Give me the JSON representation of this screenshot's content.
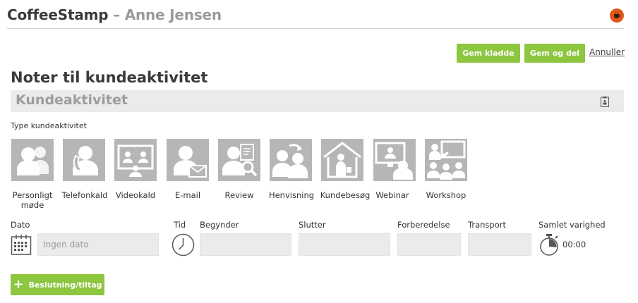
{
  "header": {
    "brand": "CoffeeStamp",
    "separator": " – ",
    "user_name": "Anne Jensen",
    "logo_icon": "coffee-cup-icon",
    "logo_color": "#e0581e"
  },
  "toolbar": {
    "save_draft_label": "Gem kladde",
    "save_share_label": "Gem og del",
    "cancel_label": "Annuller",
    "accent_color": "#8dc63f"
  },
  "page": {
    "title": "Noter til kundeaktivitet",
    "activity_title": "Kundeaktivitet",
    "attachment_icon": "clipboard-icon"
  },
  "activity_types": {
    "label": "Type kundeaktivitet",
    "items": [
      {
        "line1": "Personligt",
        "line2": "møde",
        "icon": "meeting-icon"
      },
      {
        "line1": "Telefonkald",
        "line2": "",
        "icon": "phone-call-icon"
      },
      {
        "line1": "Videokald",
        "line2": "",
        "icon": "video-call-icon"
      },
      {
        "line1": "E-mail",
        "line2": "",
        "icon": "email-icon"
      },
      {
        "line1": "Review",
        "line2": "",
        "icon": "review-icon"
      },
      {
        "line1": "Henvisning",
        "line2": "",
        "icon": "referral-icon"
      },
      {
        "line1": "Kundebesøg",
        "line2": "",
        "icon": "customer-visit-icon"
      },
      {
        "line1": "Webinar",
        "line2": "",
        "icon": "webinar-icon"
      },
      {
        "line1": "Workshop",
        "line2": "",
        "icon": "workshop-icon"
      }
    ]
  },
  "fields": {
    "date_label": "Dato",
    "date_placeholder": "Ingen dato",
    "date_value": "",
    "time_label": "Tid",
    "start_label": "Begynder",
    "start_value": "",
    "end_label": "Slutter",
    "end_value": "",
    "prep_label": "Forberedelse",
    "prep_value": "",
    "transport_label": "Transport",
    "transport_value": "",
    "total_label": "Samlet varighed",
    "total_value": "00:00"
  },
  "actions": {
    "decision_label": "Beslutning/tiltag"
  }
}
